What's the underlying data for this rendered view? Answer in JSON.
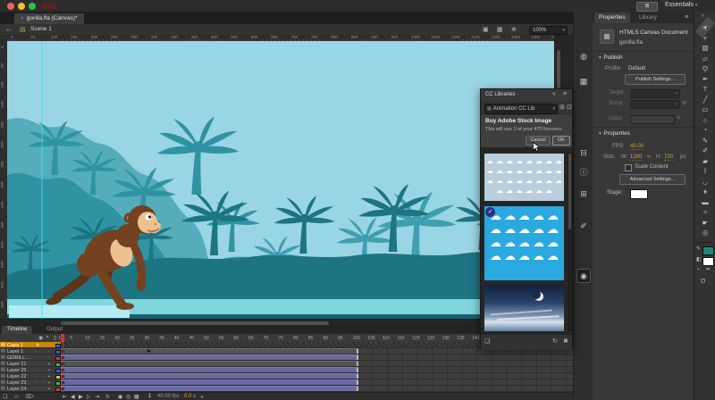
{
  "colors": {
    "stage_sky": "#9ad5e5",
    "jungle_light": "#55adbb",
    "jungle_midlight": "#3f9fae",
    "jungle_mid": "#2f93a2",
    "jungle_dark": "#1d7482",
    "walkway": "#7fd6dd",
    "walkway_shadow": "#19616f",
    "selection_highlight": "#b2ecf2",
    "guide": "#3fe3ec",
    "monkey_dark": "#5f3418",
    "monkey_body": "#74421f",
    "monkey_face": "#ecc091",
    "layer_selected": "#c9860a",
    "tween_span": "#6a6aa0",
    "static_span": "#545454",
    "value_orange": "#d9a23c",
    "stock_blue": "#2aa9e0",
    "stock_gray_blue": "#b8cedd",
    "playhead_red": "#cc3a36",
    "stroke_swatch": "#1d8a78"
  },
  "titlebar": {
    "workspace_label": "Essentials",
    "workspace_caret": "▾",
    "stock_glyph": "⊞"
  },
  "doc_tab": {
    "close_glyph": "×",
    "label": "gorilla.fla (Canvas)*"
  },
  "edit_bar": {
    "back_glyph": "←",
    "scene_icon_glyph": "▤",
    "scene_label": "Scene 1",
    "edit_scene_glyph": "▣",
    "edit_symbols_glyph": "▦",
    "center_stage_glyph": "⊕",
    "zoom_value": "100%",
    "zoom_caret": "▾"
  },
  "rulers": {
    "h_start": 0,
    "h_end": 1350,
    "step": 50,
    "v_start": 0,
    "v_end": 700
  },
  "cc_panel": {
    "title": "CC Libraries",
    "collapse_glyph": "«",
    "menu_glyph": "≡",
    "library_icon_glyph": "▤",
    "library_name": "Animation CC Lib",
    "caret": "▾",
    "grid_view_glyph": "⊞",
    "list_view_glyph": "⊡",
    "dialog": {
      "title": "Buy Adobe Stock Image",
      "message": "This will use 1 of your 470 licenses.",
      "cancel_label": "Cancel",
      "ok_label": "OK"
    },
    "footer": {
      "add_glyph": "❏",
      "sync_glyph": "↻",
      "delete_glyph": "✖"
    }
  },
  "properties_panel": {
    "tab_properties": "Properties",
    "tab_library": "Library",
    "menu_glyph": "≡",
    "doc_icon_glyph": "▦",
    "doc_type": "HTML5 Canvas Document",
    "doc_name": "gorilla.fla",
    "publish_header": "Publish",
    "profile_label": "Profile:",
    "profile_value": "Default",
    "publish_settings_label": "Publish Settings...",
    "target_label": "Target",
    "script_label": "Script",
    "class_label": "Class",
    "script_tool_glyph": "⚙",
    "class_tool_glyph": "✎",
    "properties_header": "Properties",
    "fps_label": "FPS:",
    "fps_value": "40.00",
    "size_label": "Size:",
    "w_label": "W:",
    "w_value": "1280",
    "link_glyph": "∞",
    "h_label": "H:",
    "h_value": "720",
    "px_label": "px",
    "scale_content_label": "Scale Content",
    "advanced_label": "Advanced Settings...",
    "stage_label": "Stage:"
  },
  "dock": [
    {
      "name": "color",
      "glyph": "◍"
    },
    {
      "name": "swatches",
      "glyph": "▦"
    },
    {
      "name": "align",
      "glyph": "⊟"
    },
    {
      "name": "info",
      "glyph": "ⓘ"
    },
    {
      "name": "transform",
      "glyph": "⊞"
    },
    {
      "name": "brush-library",
      "glyph": "✐"
    },
    {
      "name": "cc-libraries",
      "glyph": "◉",
      "active": true
    }
  ],
  "tools": [
    {
      "name": "selection",
      "glyph": "➤",
      "active": true
    },
    {
      "name": "subselection",
      "glyph": "➣"
    },
    {
      "name": "free-transform",
      "glyph": "▧"
    },
    {
      "name": "gradient-transform",
      "glyph": "▱"
    },
    {
      "name": "lasso",
      "glyph": "Ϙ"
    },
    {
      "name": "pen",
      "glyph": "✒"
    },
    {
      "name": "text",
      "glyph": "T"
    },
    {
      "name": "line",
      "glyph": "╱"
    },
    {
      "name": "rectangle",
      "glyph": "▭"
    },
    {
      "name": "oval",
      "glyph": "○"
    },
    {
      "name": "polystar",
      "glyph": "◔"
    },
    {
      "name": "pencil",
      "glyph": "✎"
    },
    {
      "name": "brush",
      "glyph": "✐"
    },
    {
      "name": "paint-brush",
      "glyph": "▰"
    },
    {
      "name": "bone",
      "glyph": "ſ"
    },
    {
      "name": "paint-bucket",
      "glyph": "◡"
    },
    {
      "name": "eyedropper",
      "glyph": "♦"
    },
    {
      "name": "eraser",
      "glyph": "▬"
    },
    {
      "name": "width",
      "glyph": "≈"
    },
    {
      "name": "hand",
      "glyph": "☛"
    },
    {
      "name": "zoom",
      "glyph": "◎"
    }
  ],
  "timeline": {
    "tab_timeline": "Timeline",
    "tab_output": "Output",
    "header_icons": {
      "eye": "◉",
      "lock": "▪",
      "outline": "▯"
    },
    "frames": {
      "first": 1,
      "last": 140,
      "step": 5
    },
    "span_end_frame": 100,
    "layers": [
      {
        "name": "Capa 1",
        "selected": true,
        "pencil": true,
        "locked": false,
        "color": "#3d5afe",
        "span": "hatch"
      },
      {
        "name": "Layer 1",
        "selected": false,
        "locked": false,
        "color": "#3d5afe",
        "span": "gray",
        "marker_frame": 30
      },
      {
        "name": "GORILL…",
        "selected": false,
        "locked": false,
        "color": "#e23a2e",
        "span": "purple"
      },
      {
        "name": "Layer 21",
        "selected": false,
        "locked": true,
        "color": "#2fbf4f",
        "span": "gray"
      },
      {
        "name": "Layer 25",
        "selected": false,
        "locked": true,
        "color": "#3d5afe",
        "span": "purple"
      },
      {
        "name": "Layer 22",
        "selected": false,
        "locked": true,
        "color": "#e8c21a",
        "span": "purple"
      },
      {
        "name": "Layer 23",
        "selected": false,
        "locked": true,
        "color": "#2fbf4f",
        "span": "purple"
      },
      {
        "name": "Layer 24",
        "selected": false,
        "locked": true,
        "color": "#e23a2e",
        "span": "purple"
      }
    ],
    "footer": {
      "new_layer_glyph": "❏",
      "new_folder_glyph": "▱",
      "delete_glyph": "⌦",
      "controls": [
        {
          "name": "go-first",
          "glyph": "⇤"
        },
        {
          "name": "step-back",
          "glyph": "◀"
        },
        {
          "name": "play",
          "glyph": "▶"
        },
        {
          "name": "step-forward",
          "glyph": "▷"
        },
        {
          "name": "go-last",
          "glyph": "⇥"
        }
      ],
      "loop_glyph": "↻",
      "onion": [
        {
          "name": "onion-skin",
          "glyph": "◉"
        },
        {
          "name": "onion-outline",
          "glyph": "◎"
        },
        {
          "name": "edit-multiple-frames",
          "glyph": "▦"
        }
      ],
      "frame_indicator": "1",
      "fps_text": "40.00 fps",
      "time_text": "0.0 s",
      "scroll_left_glyph": "◂"
    }
  }
}
